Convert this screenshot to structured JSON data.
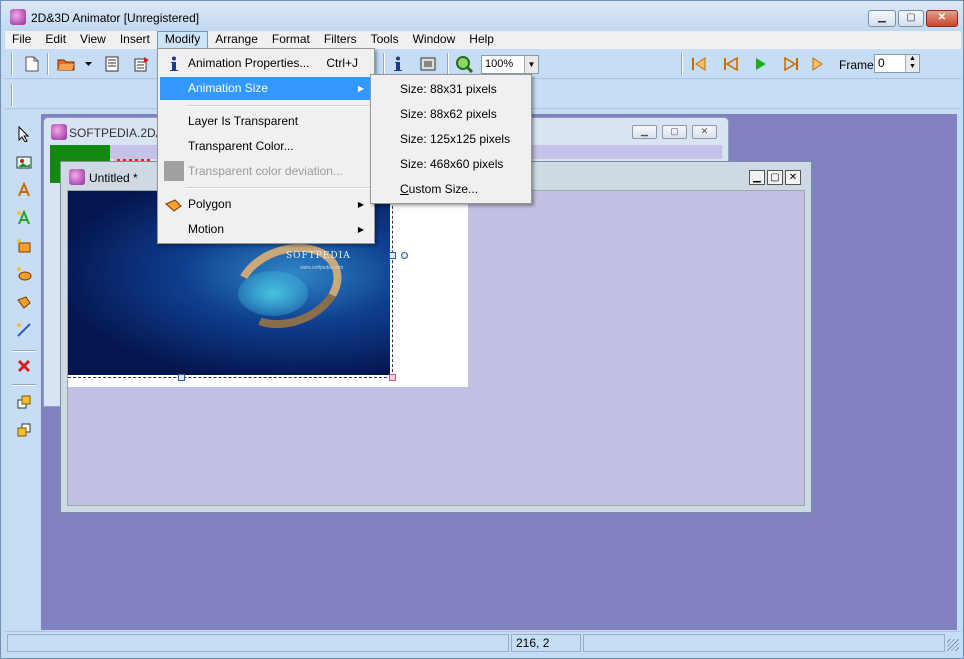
{
  "app": {
    "title": "2D&3D Animator [Unregistered]",
    "min_glyph": "▁",
    "max_glyph": "▢",
    "close_glyph": "✕"
  },
  "menubar": {
    "items": [
      "File",
      "Edit",
      "View",
      "Insert",
      "Modify",
      "Arrange",
      "Format",
      "Filters",
      "Tools",
      "Window",
      "Help"
    ],
    "active": "Modify"
  },
  "toolbar": {
    "zoom_value": "100%",
    "frame_label": "Frame:",
    "frame_value": "0",
    "dropdown_glyph": "▼",
    "spin_up": "▲",
    "spin_down": "▼"
  },
  "documents": {
    "back_title": "SOFTPEDIA.2DA",
    "front_title": "Untitled *",
    "photo_brand": "SOFTPEDIA",
    "photo_url": "www.softpedia.com"
  },
  "modify_menu": {
    "items": [
      {
        "label": "Animation Properties...",
        "shortcut": "Ctrl+J",
        "icon": "info-icon"
      },
      {
        "label": "Animation Size",
        "submenu": true,
        "highlighted": true
      },
      {
        "label": "Layer Is Transparent"
      },
      {
        "label": "Transparent Color..."
      },
      {
        "label": "Transparent color deviation...",
        "disabled": true,
        "icon": "gray-swatch-icon"
      },
      {
        "label": "Polygon",
        "submenu": true,
        "icon": "polygon-icon"
      },
      {
        "label": "Motion",
        "submenu": true
      }
    ],
    "submenu_arrow": "▶"
  },
  "animation_size_submenu": {
    "items": [
      "Size: 88x31 pixels",
      "Size: 88x62 pixels",
      "Size: 125x125 pixels",
      "Size: 468x60 pixels"
    ],
    "custom_prefix": "C",
    "custom_rest": "ustom Size..."
  },
  "statusbar": {
    "coords": "216, 2"
  },
  "colors": {
    "menu_highlight": "#3399ff",
    "workspace": "#8281c0",
    "toolbar": "#c6ddf4"
  }
}
